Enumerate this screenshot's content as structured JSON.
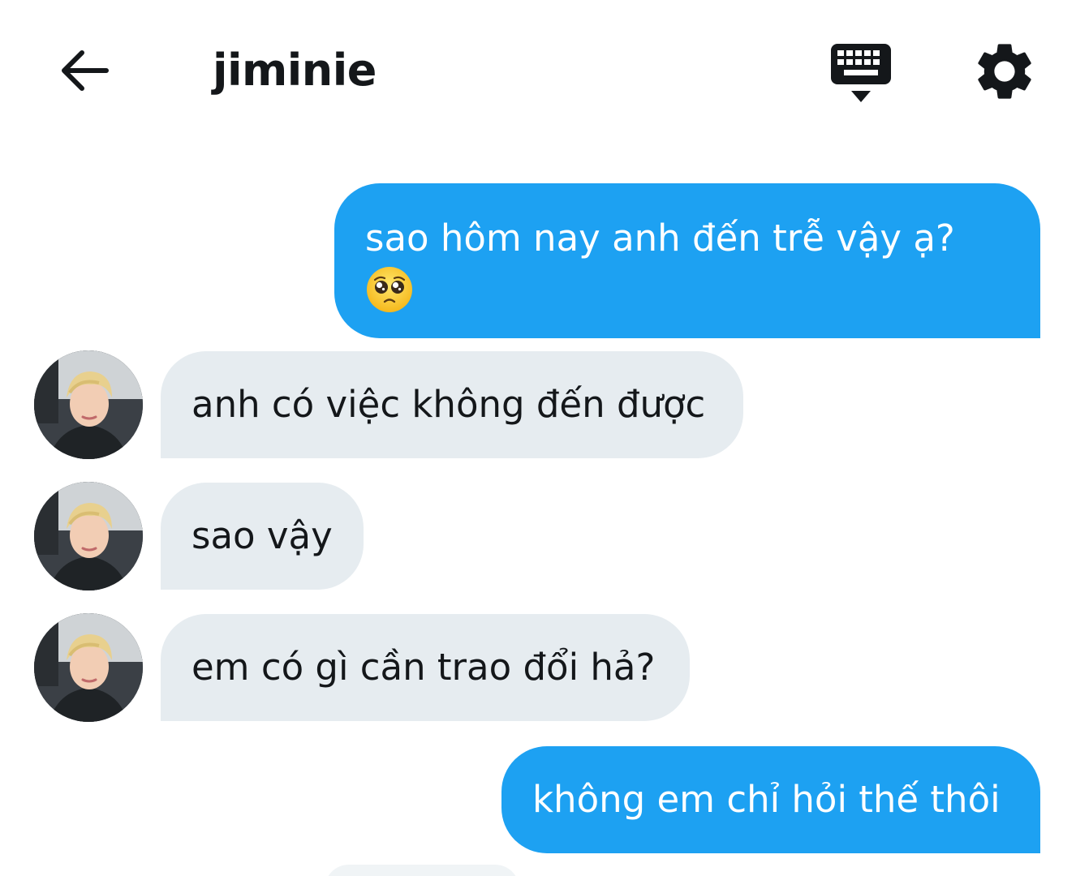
{
  "header": {
    "back_icon": "arrow-left-icon",
    "title": "jiminie",
    "keyboard_icon": "keyboard-hide-icon",
    "settings_icon": "gear-icon"
  },
  "colors": {
    "sent_bubble": "#1da1f2",
    "received_bubble": "#e6ecf0",
    "text_dark": "#14171a"
  },
  "messages": [
    {
      "direction": "sent",
      "text": "sao hôm nay anh đến trễ vậy ạ?",
      "emoji": "pleading-face-emoji"
    },
    {
      "direction": "received",
      "text": "anh có việc không đến được",
      "avatar": "avatar"
    },
    {
      "direction": "received",
      "text": "sao vậy",
      "avatar": "avatar"
    },
    {
      "direction": "received",
      "text": "em có gì cần trao đổi hả?",
      "avatar": "avatar"
    },
    {
      "direction": "sent",
      "text": "không em chỉ hỏi thế thôi"
    }
  ]
}
